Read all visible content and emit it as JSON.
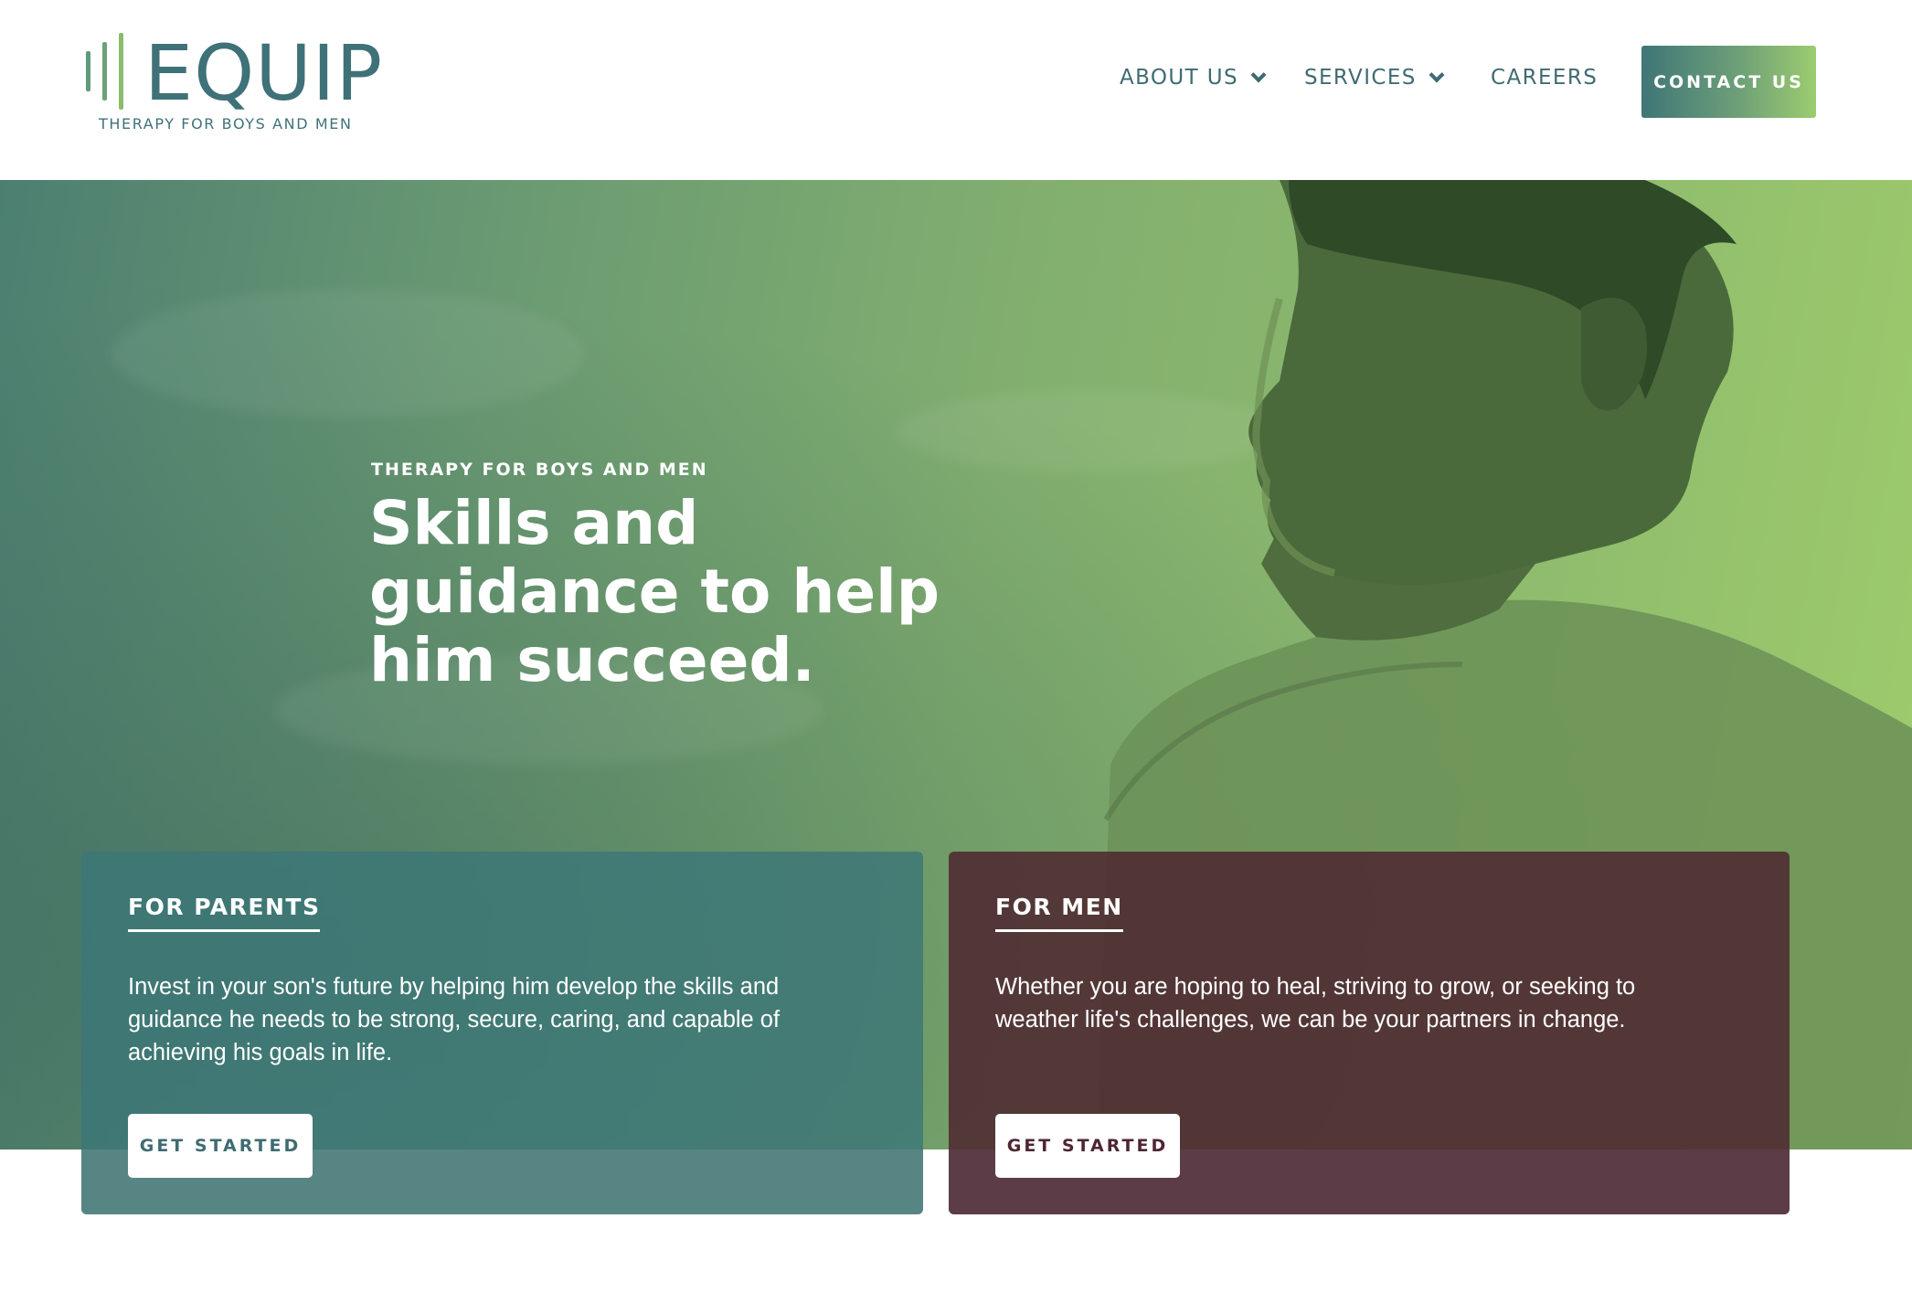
{
  "brand": {
    "name": "EQUIP",
    "tagline": "THERAPY FOR BOYS AND MEN"
  },
  "nav": {
    "items": [
      {
        "label": "ABOUT US",
        "has_dropdown": true
      },
      {
        "label": "SERVICES",
        "has_dropdown": true
      },
      {
        "label": "CAREERS",
        "has_dropdown": false
      }
    ],
    "contact_label": "CONTACT US"
  },
  "hero": {
    "eyebrow": "THERAPY FOR BOYS AND MEN",
    "title": "Skills and guidance to help him succeed."
  },
  "cards": [
    {
      "title": "FOR PARENTS",
      "text": "Invest in your son's future by helping him develop the skills and guidance he needs to be strong, secure, caring, and capable of achieving his goals in life.",
      "button": "GET STARTED"
    },
    {
      "title": "FOR MEN",
      "text": "Whether you are hoping to heal, striving to grow, or seeking to weather life's challenges, we can be your partners in change.",
      "button": "GET STARTED"
    }
  ],
  "colors": {
    "brand_teal": "#3f7178",
    "accent_green": "#9ccc6f",
    "men_card": "#4e2630"
  },
  "icons": {
    "dropdown": "chevron-down-icon"
  }
}
